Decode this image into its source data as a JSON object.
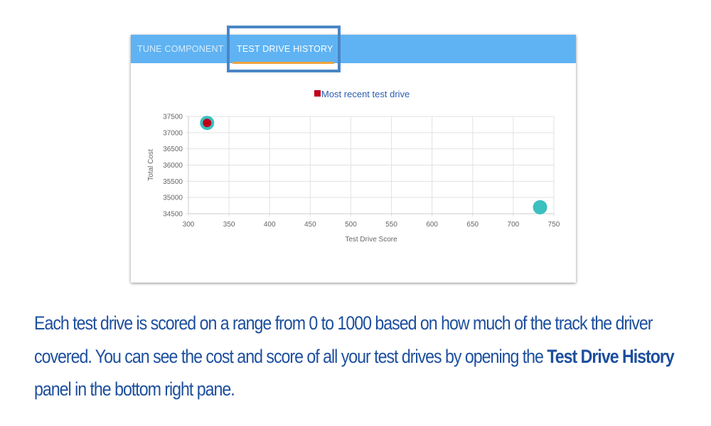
{
  "tabs": [
    {
      "label": "TUNE COMPONENT",
      "active": false
    },
    {
      "label": "TEST DRIVE HISTORY",
      "active": true
    }
  ],
  "colors": {
    "tabbar": "#5fb3f3",
    "accent": "#f0a23c",
    "highlight": "#4a86c5",
    "point": "#3bbfbf",
    "recent": "#c0001a",
    "text": "#1d4f9e"
  },
  "chart_data": {
    "type": "scatter",
    "legend": [
      "Most recent test drive"
    ],
    "legend_position": "top",
    "xlabel": "Test Drive Score",
    "ylabel": "Total Cost",
    "xlim": [
      300,
      750
    ],
    "ylim": [
      34500,
      37500
    ],
    "xticks": [
      "300",
      "350",
      "400",
      "450",
      "500",
      "550",
      "600",
      "650",
      "700",
      "750"
    ],
    "yticks": [
      "37500",
      "37000",
      "36500",
      "36000",
      "35500",
      "35000",
      "34500"
    ],
    "points": [
      {
        "x": 323,
        "y": 37300,
        "recent": true
      },
      {
        "x": 733,
        "y": 34700,
        "recent": false
      }
    ],
    "grid": true
  },
  "caption": {
    "part1": "Each test drive is scored on a range from 0 to 1000 based on how much of the track the driver covered. You can see the cost and score of all your test drives by opening the ",
    "bold": "Test Drive History",
    "part2": " panel in the bottom right pane."
  }
}
